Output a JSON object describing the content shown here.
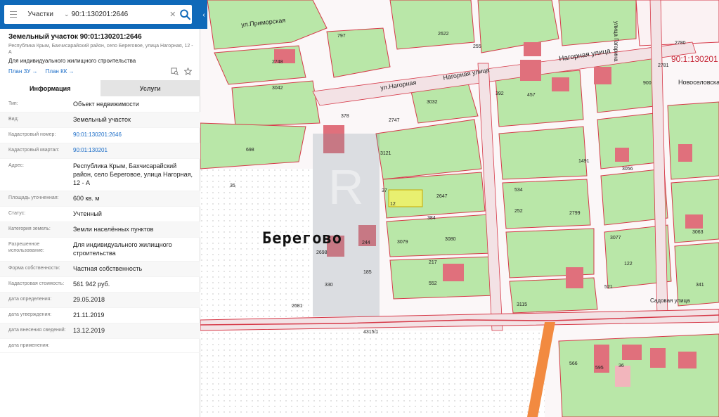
{
  "search": {
    "type_label": "Участки",
    "query": "90:1:130201:2646"
  },
  "parcel": {
    "title": "Земельный участок 90:01:130201:2646",
    "address_short": "Республика Крым, Бахчисарайский район, село Береговое, улица Нагорная, 12 - А",
    "purpose": "Для индивидуального жилищного строительства",
    "links": [
      "План ЗУ →",
      "План КК →"
    ]
  },
  "tabs": [
    "Информация",
    "Услуги"
  ],
  "fields": [
    {
      "key": "Тип:",
      "value": "Объект недвижимости"
    },
    {
      "key": "Вид:",
      "value": "Земельный участок"
    },
    {
      "key": "Кадастровый номер:",
      "value": "90:01:130201:2646",
      "link": true
    },
    {
      "key": "Кадастровый квартал:",
      "value": "90:01:130201",
      "link": true
    },
    {
      "key": "Адрес:",
      "value": "Республика Крым, Бахчисарайский район, село Береговое, улица Нагорная, 12 - А"
    },
    {
      "key": "Площадь уточненная:",
      "value": "600 кв. м"
    },
    {
      "key": "Статус:",
      "value": "Учтенный"
    },
    {
      "key": "Категория земель:",
      "value": "Земли населённых пунктов"
    },
    {
      "key": "Разрешенное использование:",
      "value": "Для индивидуального жилищного строительства"
    },
    {
      "key": "Форма собственности:",
      "value": "Частная собственность"
    },
    {
      "key": "Кадастровая стоимость:",
      "value": "561 942 руб."
    },
    {
      "key": "дата определения:",
      "value": "29.05.2018"
    },
    {
      "key": "дата утверждения:",
      "value": "21.11.2019"
    },
    {
      "key": "дата внесения сведений:",
      "value": "13.12.2019"
    },
    {
      "key": "дата применения:",
      "value": ""
    }
  ],
  "map": {
    "village": "Берегово",
    "quarter": "90:1:130201",
    "streets": [
      "ул.Приморская",
      "Нагорная улица",
      "ул.Нагорная",
      "Нагорная улица",
      "Новоселовская",
      "Садовая улица",
      "улица Гагарина"
    ],
    "labels": [
      "2748",
      "3042",
      "378",
      "698",
      "2747",
      "3032",
      "3121",
      "3079",
      "3080",
      "2647",
      "384",
      "217",
      "552",
      "1491",
      "3056",
      "534",
      "252",
      "2799",
      "3077",
      "3063",
      "122",
      "341",
      "521",
      "3115",
      "2681",
      "2698",
      "330",
      "244",
      "185",
      "4315/1",
      "2780",
      "2781",
      "900",
      "457",
      "392",
      "797",
      "255",
      "2622",
      "595",
      "566",
      "36",
      "37",
      "35",
      "12"
    ],
    "colors": {
      "parcel_green": "#b8e6a8",
      "parcel_pink": "#f6d8dc",
      "building": "#e0707c",
      "boundary": "#d63a49",
      "road": "#f0e6e8",
      "selected": "#e8f070"
    }
  }
}
